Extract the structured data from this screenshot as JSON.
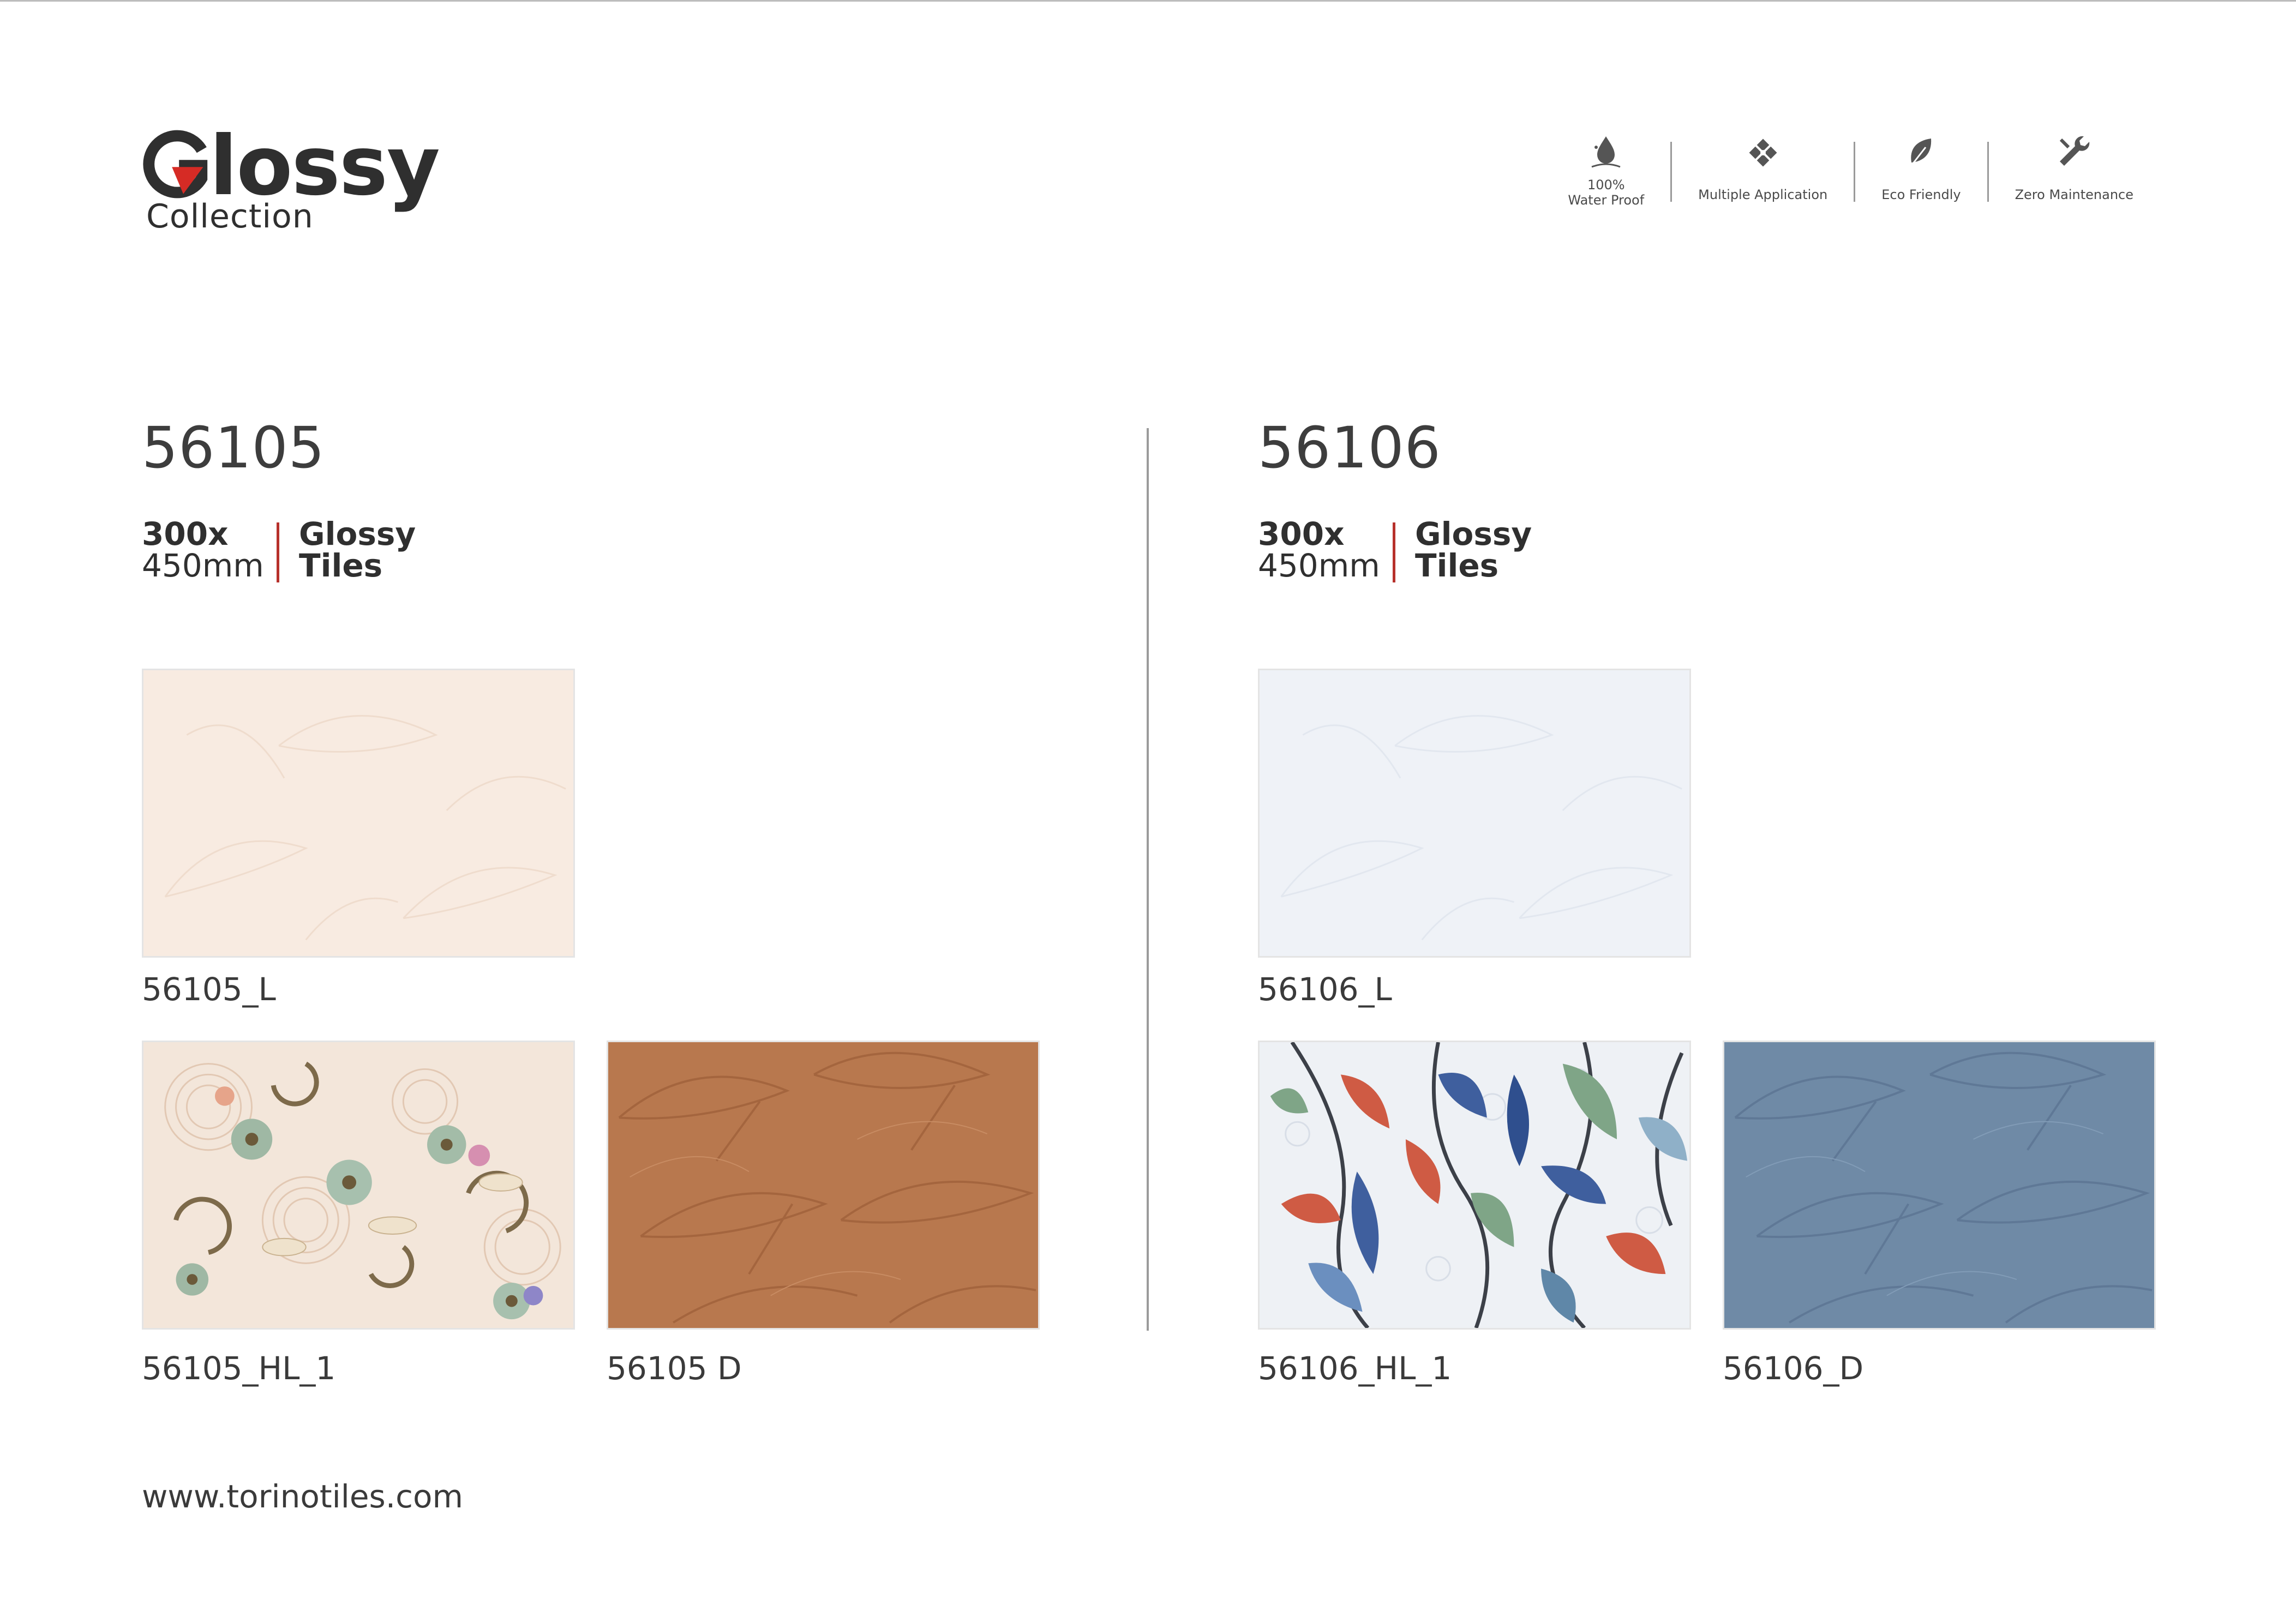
{
  "brand": {
    "logo_word": "lossy",
    "logo_subtitle": "Collection",
    "accent_color": "#d62b25"
  },
  "features": [
    {
      "icon": "water-drop-icon",
      "line1": "100%",
      "line2": "Water Proof"
    },
    {
      "icon": "multiple-application-icon",
      "line1": "",
      "line2": "Multiple Application"
    },
    {
      "icon": "leaf-icon",
      "line1": "",
      "line2": "Eco Friendly"
    },
    {
      "icon": "wrench-icon",
      "line1": "",
      "line2": "Zero Maintenance"
    }
  ],
  "products": [
    {
      "code": "56105",
      "size_line1": "300x",
      "size_line2": "450mm",
      "type_line1": "Glossy",
      "type_line2": "Tiles",
      "tiles": [
        {
          "label": "56105_L",
          "color": "#f8ebe1",
          "style": "light-leaf"
        },
        {
          "label": "56105_HL_1",
          "color": "#f3e6da",
          "style": "floral-swirl"
        },
        {
          "label": "56105 D",
          "color": "#b8784e",
          "style": "dark-leaf"
        }
      ]
    },
    {
      "code": "56106",
      "size_line1": "300x",
      "size_line2": "450mm",
      "type_line1": "Glossy",
      "type_line2": "Tiles",
      "tiles": [
        {
          "label": "56106_L",
          "color": "#eff2f7",
          "style": "light-leaf"
        },
        {
          "label": "56106_HL_1",
          "color": "#eef1f5",
          "style": "leaf-vine"
        },
        {
          "label": "56106_D",
          "color": "#6f8aa6",
          "style": "dark-leaf"
        }
      ]
    }
  ],
  "website": "www.torinotiles.com"
}
